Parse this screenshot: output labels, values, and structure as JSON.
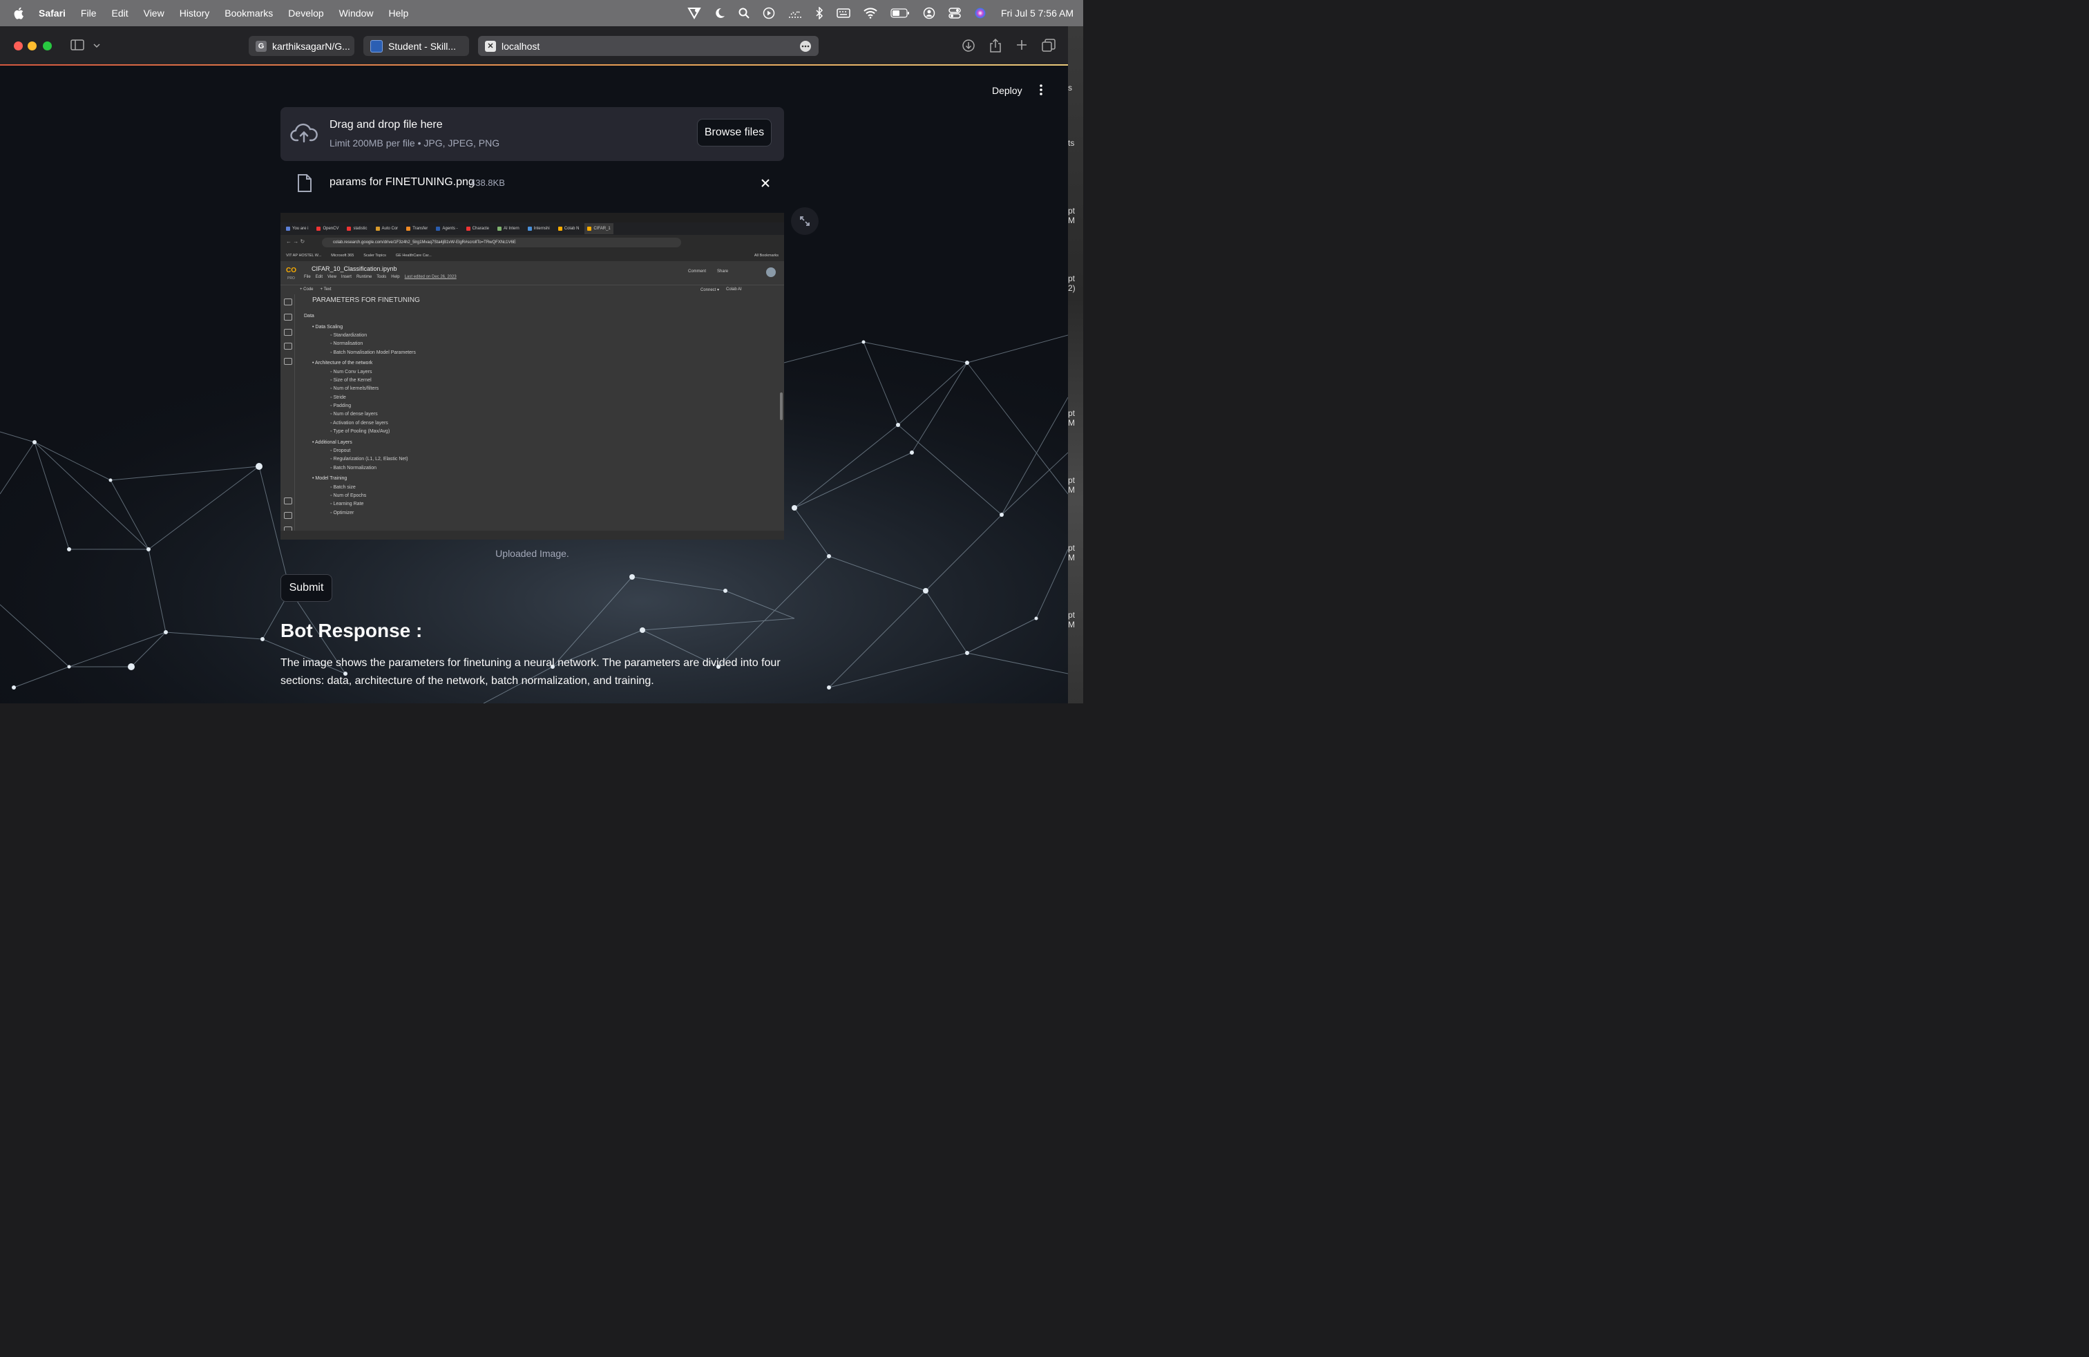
{
  "menubar": {
    "app_name": "Safari",
    "items": [
      "File",
      "Edit",
      "View",
      "History",
      "Bookmarks",
      "Develop",
      "Window",
      "Help"
    ],
    "clock": "Fri Jul 5  7:56 AM"
  },
  "desktop_strip": [
    "s",
    "ts",
    "pt\nM",
    "pt\n2)",
    "pt\nM",
    "pt\nM",
    "pt\nM",
    "pt\nM"
  ],
  "browser": {
    "tabs": [
      {
        "label": "karthiksagarN/G...",
        "favicon": "G",
        "favicon_color": "#6e6e73"
      },
      {
        "label": "Student - Skill...",
        "favicon": "",
        "favicon_color": "#2b5fb3"
      },
      {
        "label": "localhost",
        "favicon": "✕",
        "favicon_color": "#e8e8e8"
      }
    ]
  },
  "app": {
    "deploy_label": "Deploy",
    "uploader": {
      "title": "Drag and drop file here",
      "subtitle": "Limit 200MB per file • JPG, JPEG, PNG",
      "browse_label": "Browse files"
    },
    "file": {
      "name": "params for FINETUNING.png",
      "size": "438.8KB"
    },
    "caption": "Uploaded Image.",
    "submit_label": "Submit",
    "bot_title": "Bot Response :",
    "bot_text": "The image shows the parameters for finetuning a neural network. The parameters are divided into four sections: data, architecture of the network, batch normalization, and training."
  },
  "preview": {
    "tabs": [
      "You are i",
      "OpenCV",
      "statistic",
      "Auto Cor",
      "Transfer",
      "Agents -",
      "Characte",
      "AI Intern",
      "Internshi",
      "Colab N",
      "CIFAR_1"
    ],
    "url": "colab.research.google.com/drive/1F3z4h2_5lrg1Mvaq7Sta4jB1vW-ElgR#scrollTo=TRwQFXNc1V6E",
    "bookmarks": [
      "VIT AP HOSTEL W...",
      "Microsoft 365",
      "Scaler Topics",
      "GE HealthCare Car..."
    ],
    "all_bookmarks": "All Bookmarks",
    "logo": "CO",
    "pro": "PRO",
    "notebook_name": "CIFAR_10_Classification.ipynb",
    "nb_menu": [
      "File",
      "Edit",
      "View",
      "Insert",
      "Runtime",
      "Tools",
      "Help"
    ],
    "last_edited": "Last edited on Dec 26, 2023",
    "actions": [
      "Comment",
      "Share"
    ],
    "cell_left": [
      "+ Code",
      "+ Text"
    ],
    "cell_right": [
      "Connect ▾",
      "Colab AI"
    ],
    "heading": "PARAMETERS FOR FINETUNING",
    "toc": [
      {
        "level": 0,
        "text": "Data"
      },
      {
        "level": 1,
        "text": "Data Scaling"
      },
      {
        "level": 2,
        "text": "Standardization"
      },
      {
        "level": 2,
        "text": "Normalisation"
      },
      {
        "level": 2,
        "text": "Batch Nomalisation Model Parameters"
      },
      {
        "level": 1,
        "text": "Architecture of the network"
      },
      {
        "level": 2,
        "text": "Num Conv Layers"
      },
      {
        "level": 2,
        "text": "Size of the Kernel"
      },
      {
        "level": 2,
        "text": "Num of kernels/filters"
      },
      {
        "level": 2,
        "text": "Stride"
      },
      {
        "level": 2,
        "text": "Padding"
      },
      {
        "level": 2,
        "text": "Num of dense layers"
      },
      {
        "level": 2,
        "text": "Activation of dense layers"
      },
      {
        "level": 2,
        "text": "Type of Pooling (Max/Avg)"
      },
      {
        "level": 1,
        "text": "Additional Layers"
      },
      {
        "level": 2,
        "text": "Dropout"
      },
      {
        "level": 2,
        "text": "Regularization (L1, L2, Elastic Net)"
      },
      {
        "level": 2,
        "text": "Batch Normalization"
      },
      {
        "level": 1,
        "text": "Model Training"
      },
      {
        "level": 2,
        "text": "Batch size"
      },
      {
        "level": 2,
        "text": "Num of Epochs"
      },
      {
        "level": 2,
        "text": "Learning Rate"
      },
      {
        "level": 2,
        "text": "Optimizer"
      }
    ]
  },
  "icons": {
    "apple": "apple-icon",
    "cloud": "cloud-upload-icon",
    "file": "file-icon",
    "close": "close-icon",
    "expand": "expand-icon"
  },
  "colors": {
    "accent_gradient_start": "#d4583f",
    "streamlit_bg": "#0e1117",
    "uploader_bg": "#262730"
  }
}
